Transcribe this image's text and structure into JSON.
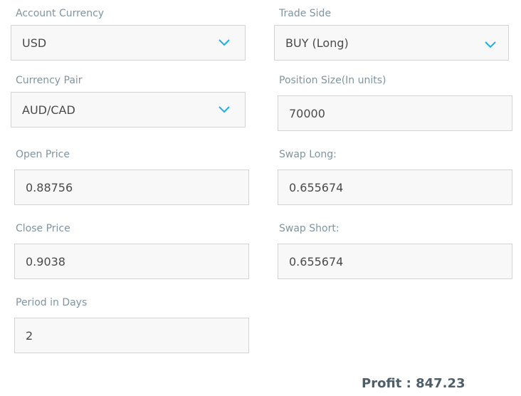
{
  "account_currency": {
    "label": "Account Currency",
    "value": "USD"
  },
  "trade_side": {
    "label": "Trade Side",
    "value": "BUY (Long)"
  },
  "currency_pair": {
    "label": "Currency Pair",
    "value": "AUD/CAD"
  },
  "position_size": {
    "label": "Position Size(In units)",
    "value": "70000"
  },
  "open_price": {
    "label": "Open Price",
    "value": "0.88756"
  },
  "swap_long": {
    "label": "Swap Long:",
    "value": "0.655674"
  },
  "close_price": {
    "label": "Close Price",
    "value": "0.9038"
  },
  "swap_short": {
    "label": "Swap Short:",
    "value": "0.655674"
  },
  "period_days": {
    "label": "Period in Days",
    "value": "2"
  },
  "result": {
    "profit_label": "Profit : 847.23"
  },
  "colors": {
    "chevron": "#1eaee8",
    "label": "#7e95a1",
    "field_bg": "#f8f8f8",
    "field_border": "#d4d4d4",
    "value_text": "#4a4a4a",
    "profit_text": "#4f5f69"
  }
}
